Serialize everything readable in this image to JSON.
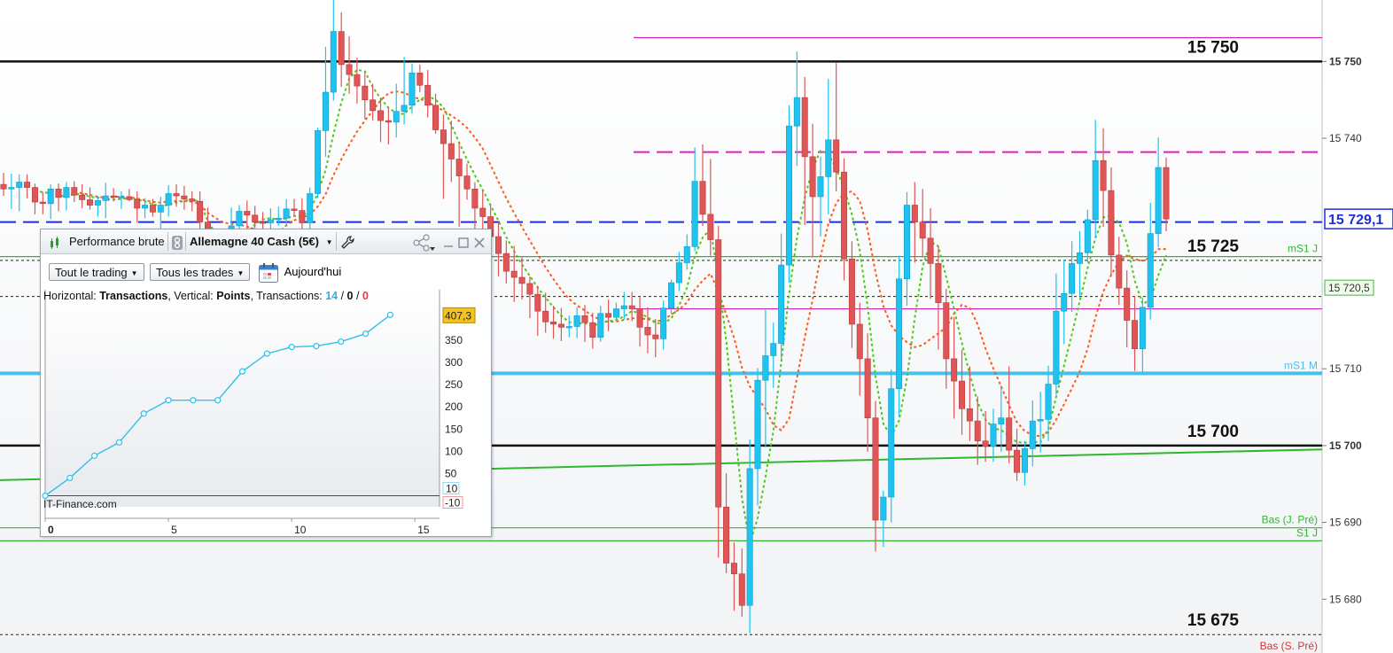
{
  "chart_data": {
    "type": "candlestick",
    "instrument": "Allemagne 40 Cash (5€)",
    "y_axis": {
      "range": [
        15673,
        15758
      ],
      "ticks": [
        15680,
        15690,
        15700,
        15710,
        15740,
        15750
      ]
    },
    "current_price": "15 729,1",
    "horizontal_levels": [
      {
        "label": "15 750",
        "price": 15750,
        "style": "solid",
        "color": "#111111"
      },
      {
        "label": "15 700",
        "price": 15700,
        "style": "solid",
        "color": "#111111"
      },
      {
        "label": "15 725",
        "price": 15724.1,
        "style": "dotted",
        "color": "#222222"
      },
      {
        "label": "15 675",
        "price": 15675.4,
        "style": "dotted",
        "color": "#222222"
      },
      {
        "label": "",
        "price": 15719.4,
        "style": "dotted",
        "color": "#222222"
      },
      {
        "label": "",
        "price": 15729.1,
        "style": "dashed",
        "color": "#1f2fd6"
      },
      {
        "label": "",
        "price": 15738.2,
        "style": "dashed",
        "color": "#e020c0"
      },
      {
        "label": "",
        "price": 15753.1,
        "style": "solid",
        "color": "#d020c0"
      },
      {
        "label": "",
        "price": 15717.8,
        "style": "solid",
        "color": "#d020c0"
      },
      {
        "label": "mS1 M",
        "price": 15709.4,
        "style": "thick",
        "color": "#46c1ee"
      },
      {
        "label": "mS1 J",
        "price": 15724.6,
        "style": "solid",
        "color": "#2eb82e"
      },
      {
        "label": "Bas (J. Pré)",
        "price": 15689.3,
        "style": "solid",
        "color": "#2eb82e"
      },
      {
        "label": "S1 J",
        "price": 15687.6,
        "style": "solid",
        "color": "#2eb82e"
      },
      {
        "label": "Bas (S. Pré)",
        "price": 15672.9,
        "style": "solid",
        "color": "#e03030"
      }
    ],
    "indicator_tags": [
      {
        "label": "15 720,5",
        "price": 15720.5
      }
    ],
    "trendline": {
      "from": [
        0,
        15695.5
      ],
      "to": [
        100,
        15699.5
      ],
      "color": "#2eb82e"
    },
    "moving_averages": [
      {
        "color": "#ff5a1e",
        "style": "dotted"
      },
      {
        "color": "#4fc81c",
        "style": "dotted"
      }
    ],
    "up_color": "#1ec3f0",
    "down_color": "#e05555",
    "candles": [
      [
        15734.0,
        15735.5,
        15732.5,
        15733.4
      ],
      [
        15733.4,
        15735.4,
        15730.8,
        15733.6
      ],
      [
        15733.6,
        15735.3,
        15730.5,
        15734.3
      ],
      [
        15734.3,
        15735.3,
        15732.2,
        15733.6
      ],
      [
        15733.6,
        15734.1,
        15730.1,
        15731.7
      ],
      [
        15731.7,
        15733.0,
        15730.1,
        15731.5
      ],
      [
        15731.5,
        15734.0,
        15729.5,
        15733.4
      ],
      [
        15733.4,
        15734.1,
        15730.5,
        15732.3
      ],
      [
        15732.3,
        15734.3,
        15730.6,
        15733.6
      ],
      [
        15733.6,
        15734.4,
        15731.7,
        15732.6
      ],
      [
        15732.6,
        15734.0,
        15730.9,
        15732.0
      ],
      [
        15732.0,
        15733.6,
        15730.7,
        15731.3
      ],
      [
        15731.3,
        15732.5,
        15729.8,
        15731.9
      ],
      [
        15731.9,
        15734.2,
        15729.6,
        15732.5
      ],
      [
        15732.5,
        15733.5,
        15731.8,
        15732.4
      ],
      [
        15732.4,
        15733.1,
        15730.8,
        15732.4
      ],
      [
        15732.4,
        15733.4,
        15731.8,
        15732.0
      ],
      [
        15732.0,
        15733.1,
        15729.0,
        15730.9
      ],
      [
        15730.9,
        15732.2,
        15729.6,
        15731.3
      ],
      [
        15731.3,
        15732.1,
        15729.8,
        15730.4
      ],
      [
        15730.4,
        15732.4,
        15728.0,
        15731.3
      ],
      [
        15731.3,
        15733.9,
        15729.8,
        15732.8
      ],
      [
        15732.8,
        15734.0,
        15731.1,
        15732.5
      ],
      [
        15732.5,
        15733.8,
        15730.7,
        15732.1
      ],
      [
        15732.1,
        15733.1,
        15730.5,
        15731.8
      ],
      [
        15731.8,
        15733.1,
        15727.4,
        15729.1
      ],
      [
        15729.1,
        15731.0,
        15717.8,
        15720.8
      ],
      [
        15720.8,
        15724.8,
        15716.0,
        15724.0
      ],
      [
        15724.0,
        15727.0,
        15722.4,
        15725.6
      ],
      [
        15725.6,
        15731.0,
        15725.3,
        15728.6
      ],
      [
        15728.6,
        15731.3,
        15727.1,
        15730.5
      ],
      [
        15730.5,
        15731.9,
        15728.0,
        15730.0
      ],
      [
        15730.0,
        15731.2,
        15728.3,
        15729.1
      ],
      [
        15729.1,
        15730.4,
        15727.9,
        15729.0
      ],
      [
        15729.0,
        15730.9,
        15727.5,
        15729.4
      ],
      [
        15729.4,
        15731.1,
        15728.6,
        15729.6
      ],
      [
        15729.6,
        15732.1,
        15728.5,
        15730.8
      ],
      [
        15730.8,
        15732.1,
        15729.8,
        15730.6
      ],
      [
        15730.6,
        15732.2,
        15727.3,
        15729.0
      ],
      [
        15729.0,
        15733.6,
        15727.8,
        15732.8
      ],
      [
        15732.8,
        15741.4,
        15732.2,
        15741.0
      ],
      [
        15741.0,
        15751.9,
        15737.6,
        15746.0
      ],
      [
        15746.0,
        15758.0,
        15744.9,
        15753.9
      ],
      [
        15753.9,
        15756.4,
        15746.7,
        15749.6
      ],
      [
        15749.6,
        15753.3,
        15745.8,
        15748.3
      ],
      [
        15748.3,
        15750.5,
        15744.5,
        15746.8
      ],
      [
        15746.8,
        15748.7,
        15742.5,
        15745.0
      ],
      [
        15745.0,
        15747.1,
        15742.3,
        15743.6
      ],
      [
        15743.6,
        15745.3,
        15739.5,
        15742.3
      ],
      [
        15742.3,
        15743.9,
        15739.2,
        15742.1
      ],
      [
        15742.1,
        15747.1,
        15740.1,
        15743.5
      ],
      [
        15743.5,
        15750.6,
        15741.8,
        15744.3
      ],
      [
        15744.3,
        15749.7,
        15743.2,
        15748.5
      ],
      [
        15748.5,
        15749.6,
        15746.0,
        15746.9
      ],
      [
        15746.9,
        15748.9,
        15742.7,
        15744.3
      ],
      [
        15744.3,
        15745.8,
        15740.6,
        15741.1
      ],
      [
        15741.1,
        15743.1,
        15732.1,
        15739.3
      ],
      [
        15739.3,
        15742.3,
        15734.3,
        15737.3
      ],
      [
        15737.3,
        15739.5,
        15728.5,
        15735.1
      ],
      [
        15735.1,
        15736.7,
        15732.0,
        15733.4
      ],
      [
        15733.4,
        15734.3,
        15726.0,
        15730.9
      ],
      [
        15730.9,
        15733.2,
        15728.2,
        15729.8
      ],
      [
        15729.8,
        15731.3,
        15721.9,
        15727.2
      ],
      [
        15727.2,
        15729.1,
        15722.0,
        15725.0
      ],
      [
        15725.0,
        15726.7,
        15721.1,
        15722.7
      ],
      [
        15722.7,
        15726.0,
        15718.7,
        15721.9
      ],
      [
        15721.9,
        15724.5,
        15719.0,
        15721.1
      ],
      [
        15721.1,
        15722.0,
        15716.6,
        15719.7
      ],
      [
        15719.7,
        15720.8,
        15714.3,
        15717.5
      ],
      [
        15717.5,
        15719.9,
        15714.7,
        15716.1
      ],
      [
        15716.1,
        15718.2,
        15713.9,
        15715.8
      ],
      [
        15715.8,
        15717.9,
        15713.6,
        15715.4
      ],
      [
        15715.4,
        15716.9,
        15714.1,
        15715.5
      ],
      [
        15715.5,
        15718.0,
        15714.0,
        15716.9
      ],
      [
        15716.9,
        15718.3,
        15713.5,
        15716.0
      ],
      [
        15716.0,
        15717.3,
        15712.6,
        15714.1
      ],
      [
        15714.1,
        15718.2,
        15713.5,
        15717.2
      ],
      [
        15717.2,
        15719.0,
        15714.9,
        15716.7
      ],
      [
        15716.7,
        15718.6,
        15716.3,
        15717.8
      ],
      [
        15717.8,
        15720.0,
        15716.4,
        15718.2
      ],
      [
        15718.2,
        15720.0,
        15716.2,
        15717.8
      ],
      [
        15717.8,
        15719.3,
        15712.9,
        15715.4
      ],
      [
        15715.4,
        15718.0,
        15712.0,
        15714.4
      ],
      [
        15714.4,
        15716.5,
        15711.5,
        15713.9
      ],
      [
        15713.9,
        15718.9,
        15712.5,
        15717.9
      ],
      [
        15717.9,
        15721.6,
        15717.1,
        15721.2
      ],
      [
        15721.2,
        15725.2,
        15720.1,
        15723.8
      ],
      [
        15723.8,
        15727.5,
        15722.9,
        15725.9
      ],
      [
        15725.9,
        15738.8,
        15725.3,
        15734.4
      ],
      [
        15734.4,
        15739.2,
        15728.6,
        15730.1
      ],
      [
        15730.1,
        15737.3,
        15724.7,
        15726.8
      ],
      [
        15726.8,
        15728.6,
        15685.4,
        15692.0
      ],
      [
        15692.0,
        15696.4,
        15683.4,
        15684.7
      ],
      [
        15684.7,
        15687.4,
        15678.5,
        15683.3
      ],
      [
        15683.3,
        15686.6,
        15677.7,
        15679.2
      ],
      [
        15679.2,
        15700.8,
        15675.6,
        15697.0
      ],
      [
        15697.0,
        15710.1,
        15692.2,
        15708.5
      ],
      [
        15708.5,
        15717.9,
        15699.8,
        15711.7
      ],
      [
        15711.7,
        15716.0,
        15707.5,
        15713.3
      ],
      [
        15713.3,
        15727.6,
        15711.2,
        15723.5
      ],
      [
        15723.5,
        15744.3,
        15721.2,
        15741.6
      ],
      [
        15741.6,
        15751.3,
        15736.4,
        15745.3
      ],
      [
        15745.3,
        15748.0,
        15728.7,
        15737.6
      ],
      [
        15737.6,
        15741.9,
        15724.5,
        15732.4
      ],
      [
        15732.4,
        15737.6,
        15727.2,
        15735.0
      ],
      [
        15735.0,
        15747.7,
        15730.1,
        15739.8
      ],
      [
        15739.8,
        15749.8,
        15733.1,
        15735.6
      ],
      [
        15735.6,
        15737.4,
        15721.5,
        15724.3
      ],
      [
        15724.3,
        15726.6,
        15712.7,
        15715.8
      ],
      [
        15715.8,
        15718.6,
        15706.5,
        15711.3
      ],
      [
        15711.3,
        15714.6,
        15699.2,
        15703.6
      ],
      [
        15703.6,
        15705.8,
        15686.2,
        15690.3
      ],
      [
        15690.3,
        15694.1,
        15686.8,
        15693.3
      ],
      [
        15693.3,
        15709.9,
        15690.0,
        15707.4
      ],
      [
        15707.4,
        15724.7,
        15703.8,
        15721.7
      ],
      [
        15721.7,
        15733.0,
        15718.2,
        15731.3
      ],
      [
        15731.3,
        15734.3,
        15723.8,
        15729.1
      ],
      [
        15729.1,
        15733.4,
        15724.5,
        15727.0
      ],
      [
        15727.0,
        15730.9,
        15719.1,
        15723.7
      ],
      [
        15723.7,
        15726.0,
        15712.5,
        15718.6
      ],
      [
        15718.6,
        15720.4,
        15707.4,
        15711.3
      ],
      [
        15711.3,
        15716.7,
        15703.5,
        15708.4
      ],
      [
        15708.4,
        15712.5,
        15701.4,
        15704.8
      ],
      [
        15704.8,
        15710.3,
        15700.6,
        15703.2
      ],
      [
        15703.2,
        15706.4,
        15697.5,
        15700.6
      ],
      [
        15700.6,
        15704.5,
        15697.9,
        15699.9
      ],
      [
        15699.9,
        15704.8,
        15697.9,
        15702.8
      ],
      [
        15702.8,
        15707.8,
        15699.2,
        15703.6
      ],
      [
        15703.6,
        15710.3,
        15697.7,
        15699.4
      ],
      [
        15699.4,
        15702.2,
        15695.4,
        15696.5
      ],
      [
        15696.5,
        15700.6,
        15694.8,
        15699.6
      ],
      [
        15699.6,
        15705.9,
        15697.3,
        15703.2
      ],
      [
        15703.2,
        15707.0,
        15699.1,
        15703.4
      ],
      [
        15703.4,
        15710.4,
        15700.6,
        15708.0
      ],
      [
        15708.0,
        15722.4,
        15706.6,
        15717.5
      ],
      [
        15717.5,
        15724.1,
        15713.2,
        15719.8
      ],
      [
        15719.8,
        15726.6,
        15717.4,
        15723.7
      ],
      [
        15723.7,
        15727.9,
        15719.5,
        15725.1
      ],
      [
        15725.1,
        15730.7,
        15723.8,
        15729.4
      ],
      [
        15729.4,
        15742.4,
        15727.0,
        15737.1
      ],
      [
        15737.1,
        15741.3,
        15728.5,
        15733.2
      ],
      [
        15733.2,
        15736.2,
        15722.2,
        15724.8
      ],
      [
        15724.8,
        15727.2,
        15718.3,
        15720.5
      ],
      [
        15720.5,
        15722.8,
        15712.8,
        15716.3
      ],
      [
        15716.3,
        15719.5,
        15709.7,
        15712.6
      ],
      [
        15712.6,
        15719.3,
        15709.3,
        15718.0
      ],
      [
        15718.0,
        15731.6,
        15716.4,
        15727.6
      ],
      [
        15727.6,
        15740.1,
        15725.8,
        15736.2
      ],
      [
        15736.2,
        15737.5,
        15727.9,
        15729.5
      ]
    ]
  },
  "perf_panel": {
    "title": "Performance brute",
    "instrument_label": "Allemagne 40 Cash (5€)",
    "filter_trading": "Tout le trading",
    "filter_trades": "Tous les trades",
    "date_label": "Aujourd'hui",
    "axis_desc": {
      "h_prefix": "Horizontal: ",
      "h_value": "Transactions",
      "v_prefix": ", Vertical: ",
      "v_value": "Points",
      "t_prefix": ", Transactions: ",
      "t_total": "14",
      "sep1": " / ",
      "t_mid": "0",
      "sep2": " / ",
      "t_last": "0"
    },
    "watermark": "IT-Finance.com",
    "current_value": "407,3",
    "y_ticks": [
      350,
      300,
      250,
      200,
      150,
      100,
      50
    ],
    "baseline_tag_pos": "10",
    "baseline_tag_neg": "-10",
    "x_ticks": [
      {
        "value": 0,
        "label": "0"
      },
      {
        "value": 5,
        "label": "5"
      },
      {
        "value": 10,
        "label": "10"
      },
      {
        "value": 15,
        "label": "15"
      }
    ],
    "equity_curve": [
      [
        0,
        0
      ],
      [
        1,
        40
      ],
      [
        2,
        90
      ],
      [
        3,
        120
      ],
      [
        4,
        185
      ],
      [
        5,
        215
      ],
      [
        6,
        215
      ],
      [
        7,
        215
      ],
      [
        8,
        280
      ],
      [
        9,
        320
      ],
      [
        10,
        335
      ],
      [
        11,
        337
      ],
      [
        12,
        347
      ],
      [
        13,
        365
      ],
      [
        14,
        407.3
      ]
    ]
  }
}
